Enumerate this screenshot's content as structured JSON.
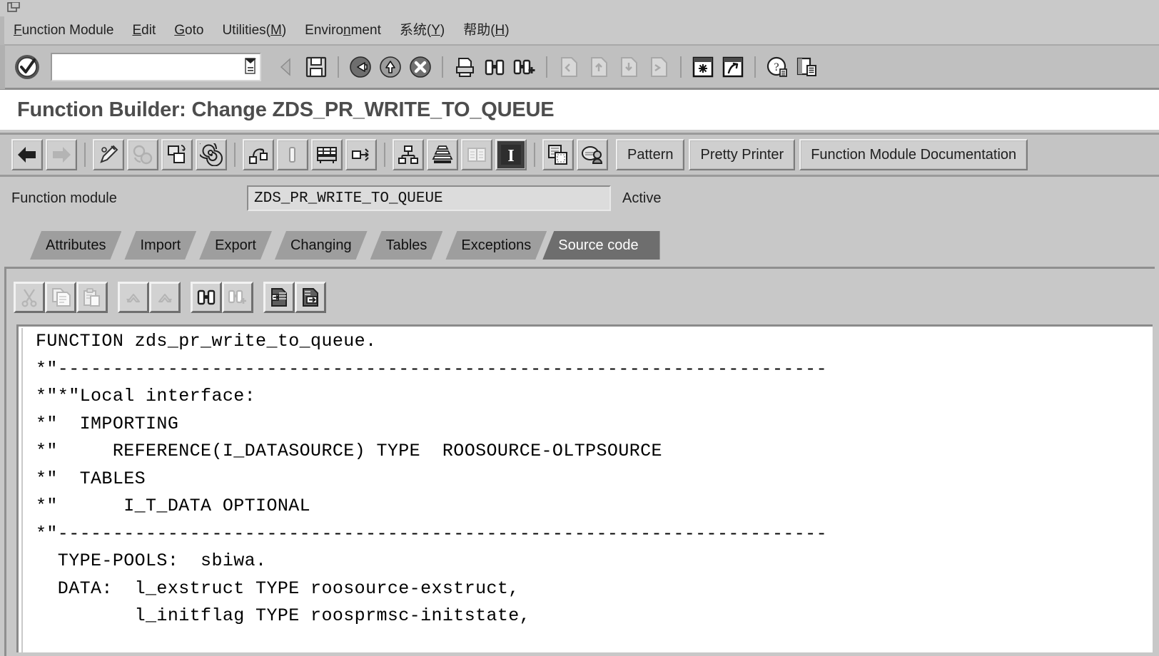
{
  "window": {
    "icon": "window-exit-icon"
  },
  "menubar": {
    "items": [
      {
        "label": "Function Module",
        "accel": "F"
      },
      {
        "label": "Edit",
        "accel": "E"
      },
      {
        "label": "Goto",
        "accel": "G"
      },
      {
        "label": "Utilities(M)",
        "accel": "M"
      },
      {
        "label": "Environment",
        "accel": "n"
      },
      {
        "label": "系统(Y)",
        "accel": "Y"
      },
      {
        "label": "帮助(H)",
        "accel": "H"
      }
    ]
  },
  "system_toolbar": {
    "ok_button": "enter-ok-icon",
    "command_field": {
      "value": "",
      "placeholder": ""
    },
    "icons": [
      "back-arrow-icon",
      "save-icon",
      "back-green-icon",
      "exit-yellow-icon",
      "cancel-red-icon",
      "print-icon",
      "find-icon",
      "find-next-icon",
      "first-page-icon",
      "previous-page-icon",
      "next-page-icon",
      "last-page-icon",
      "create-session-icon",
      "create-shortcut-icon",
      "help-icon",
      "customize-layout-icon"
    ]
  },
  "page": {
    "title": "Function Builder: Change ZDS_PR_WRITE_TO_QUEUE"
  },
  "app_toolbar": {
    "icons": [
      "back-left-arrow-icon",
      "forward-right-arrow-icon",
      "display-change-icon",
      "check-object-icon",
      "activate-icon",
      "pattern-spiral-icon",
      "navigation-stack-icon",
      "where-used-list-icon",
      "insert-statement-icon",
      "object-navigator-icon",
      "hierarchy-icon",
      "stack-icon",
      "split-screen-icon",
      "information-icon",
      "copy-object-icon",
      "user-object-icon"
    ],
    "buttons": [
      {
        "label": "Pattern"
      },
      {
        "label": "Pretty Printer"
      },
      {
        "label": "Function Module Documentation"
      }
    ]
  },
  "function_module_row": {
    "label": "Function module",
    "value": "ZDS_PR_WRITE_TO_QUEUE",
    "status": "Active"
  },
  "tabs": [
    {
      "label": "Attributes",
      "active": false
    },
    {
      "label": "Import",
      "active": false
    },
    {
      "label": "Export",
      "active": false
    },
    {
      "label": "Changing",
      "active": false
    },
    {
      "label": "Tables",
      "active": false
    },
    {
      "label": "Exceptions",
      "active": false
    },
    {
      "label": "Source code",
      "active": true
    }
  ],
  "editor_toolbar": {
    "icons": [
      "cut-icon",
      "copy-icon",
      "paste-icon",
      "undo-icon",
      "redo-icon",
      "find-icon",
      "find-next-icon",
      "import-file-icon",
      "export-file-icon"
    ]
  },
  "code": {
    "lines": [
      "FUNCTION zds_pr_write_to_queue.",
      "*\"----------------------------------------------------------------------",
      "*\"*\"Local interface:",
      "*\"  IMPORTING",
      "*\"     REFERENCE(I_DATASOURCE) TYPE  ROOSOURCE-OLTPSOURCE",
      "*\"  TABLES",
      "*\"      I_T_DATA OPTIONAL",
      "*\"----------------------------------------------------------------------",
      "  TYPE-POOLS:  sbiwa.",
      "  DATA:  l_exstruct TYPE roosource-exstruct,",
      "         l_initflag TYPE roosprmsc-initstate,"
    ]
  },
  "colors": {
    "window_bg": "#c8c8c8",
    "toolbar_bg": "#c0c0c0",
    "tab_inactive": "#9e9e9e",
    "tab_active": "#6e6e6e",
    "title_text": "#4d4d4d",
    "code_bg": "#ffffff",
    "code_text": "#000000"
  }
}
